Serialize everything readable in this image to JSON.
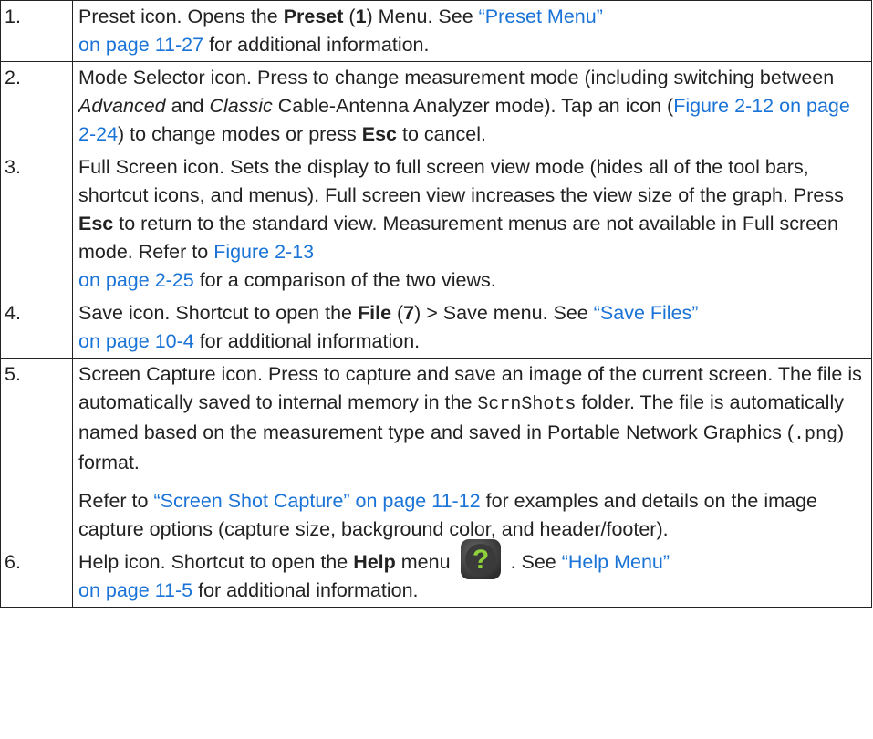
{
  "rows": [
    {
      "num": "1.",
      "t1": "Preset icon. Opens the ",
      "b1": "Preset",
      "t2": " (",
      "b2": "1",
      "t3": ") Menu. See ",
      "link1a": "“Preset Menu”",
      "link1b": "on page 11-27",
      "t4": " for additional information."
    },
    {
      "num": "2.",
      "t1": "Mode Selector icon. Press to change measurement mode (including switching between ",
      "i1": "Advanced",
      "t2": " and ",
      "i2": "Classic",
      "t3": " Cable-Antenna Analyzer mode). Tap an icon (",
      "link1": "Figure 2-12 on page 2-24",
      "t4": ") to change modes or press ",
      "b1": "Esc",
      "t5": " to cancel."
    },
    {
      "num": "3.",
      "t1": "Full Screen icon. Sets the display to full screen view mode (hides all of the tool bars, shortcut icons, and menus). Full screen view increases the view size of the graph. Press ",
      "b1": "Esc",
      "t2": " to return to the standard view. Measurement menus are not available in Full screen mode. Refer to ",
      "link1a": "Figure 2-13",
      "link1b": "on page 2-25",
      "t3": " for a comparison of the two views."
    },
    {
      "num": "4.",
      "t1": "Save icon. Shortcut to open the ",
      "b1": "File",
      "t2": " (",
      "b2": "7",
      "t3": ") > Save menu. See ",
      "link1a": "“Save Files”",
      "link1b": "on page 10-4",
      "t4": " for additional information."
    },
    {
      "num": "5.",
      "p1_t1": "Screen Capture icon. Press to capture and save an image of the current screen. The file is automatically saved to internal memory in the ",
      "p1_code1": "ScrnShots",
      "p1_t2": " folder. The file is automatically named based on the measurement type and saved in Portable Network Graphics (",
      "p1_code2": ".png",
      "p1_t3": ") format.",
      "p2_t1": "Refer to ",
      "p2_link1": "“Screen Shot Capture” on page 11-12",
      "p2_t2": " for examples and details on the image capture options (capture size, background color, and header/footer)."
    },
    {
      "num": "6.",
      "t1": "Help icon. Shortcut to open the ",
      "b1": "Help",
      "t2": " menu",
      "t3": ". See ",
      "link1a": "“Help Menu”",
      "link1b": "on page 11-5",
      "t4": " for additional information."
    }
  ],
  "colors": {
    "link": "#1a73d6",
    "text": "#222222",
    "border": "#222222",
    "help_icon_bg": "#4a4a4a",
    "help_icon_glyph": "#8fd13a"
  },
  "icons": {
    "help": "help-question-icon"
  }
}
